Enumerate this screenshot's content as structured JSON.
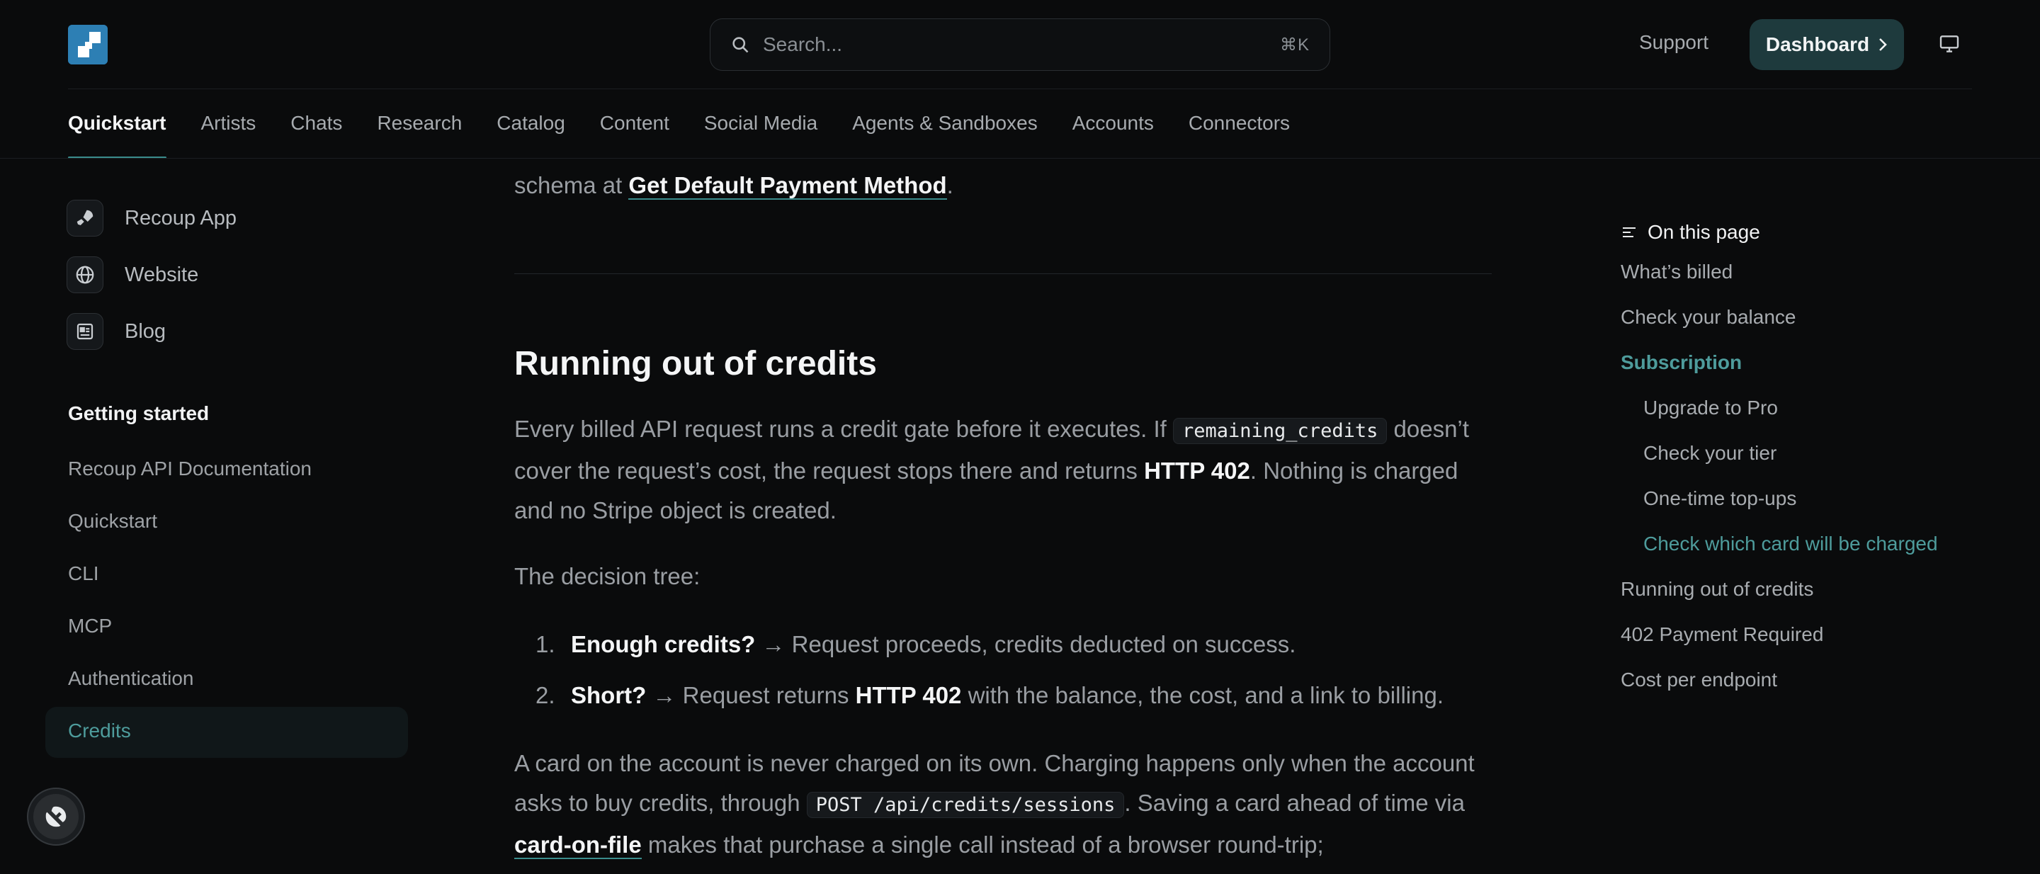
{
  "header": {
    "search_placeholder": "Search...",
    "search_shortcut": "⌘K",
    "support_label": "Support",
    "dashboard_label": "Dashboard",
    "tabs": [
      {
        "label": "Quickstart",
        "active": true
      },
      {
        "label": "Artists"
      },
      {
        "label": "Chats"
      },
      {
        "label": "Research"
      },
      {
        "label": "Catalog"
      },
      {
        "label": "Content"
      },
      {
        "label": "Social Media"
      },
      {
        "label": "Agents & Sandboxes"
      },
      {
        "label": "Accounts"
      },
      {
        "label": "Connectors"
      }
    ]
  },
  "sidebar": {
    "links": [
      {
        "label": "Recoup App",
        "icon": "rocket-icon"
      },
      {
        "label": "Website",
        "icon": "globe-icon"
      },
      {
        "label": "Blog",
        "icon": "newspaper-icon"
      }
    ],
    "section_heading": "Getting started",
    "items": [
      {
        "label": "Recoup API Documentation"
      },
      {
        "label": "Quickstart"
      },
      {
        "label": "CLI"
      },
      {
        "label": "MCP"
      },
      {
        "label": "Authentication"
      },
      {
        "label": "Credits",
        "active": true
      }
    ]
  },
  "content": {
    "intro_prefix": "schema at ",
    "intro_link": "Get Default Payment Method",
    "intro_suffix": ".",
    "heading": "Running out of credits",
    "p1_part1": "Every billed API request runs a credit gate before it executes. If ",
    "p1_code": "remaining_credits",
    "p1_part2": " doesn’t cover the request’s cost, the request stops there and returns ",
    "p1_strong": "HTTP 402",
    "p1_part3": ". Nothing is charged and no Stripe object is created.",
    "p2": "The decision tree:",
    "list": [
      {
        "num": "1.",
        "strong": "Enough credits?",
        "text": " → Request proceeds, credits deducted on success."
      },
      {
        "num": "2.",
        "strong": "Short?",
        "text": " → Request returns ",
        "strong2": "HTTP 402",
        "text2": " with the balance, the cost, and a link to billing."
      }
    ],
    "p3_part1": "A card on the account is never charged on its own. Charging happens only when the account asks to buy credits, through ",
    "p3_code": "POST /api/credits/sessions",
    "p3_part2": ". Saving a card ahead of time via ",
    "p3_link": "card-on-file",
    "p3_part3": " makes that purchase a single call instead of a browser round-trip;"
  },
  "toc": {
    "title": "On this page",
    "items": [
      {
        "label": "What’s billed"
      },
      {
        "label": "Check your balance"
      },
      {
        "label": "Subscription",
        "active": true
      },
      {
        "label": "Upgrade to Pro",
        "sub": true
      },
      {
        "label": "Check your tier",
        "sub": true
      },
      {
        "label": "One-time top-ups",
        "sub": true
      },
      {
        "label": "Check which card will be charged",
        "sub": true,
        "active": true
      },
      {
        "label": "Running out of credits"
      },
      {
        "label": "402 Payment Required"
      },
      {
        "label": "Cost per endpoint"
      }
    ]
  },
  "colors": {
    "background": "#0a0b0c",
    "accent": "#4e9c9c",
    "dashboard_button": "#1e3a3d",
    "logo": "#2d7fb4"
  }
}
